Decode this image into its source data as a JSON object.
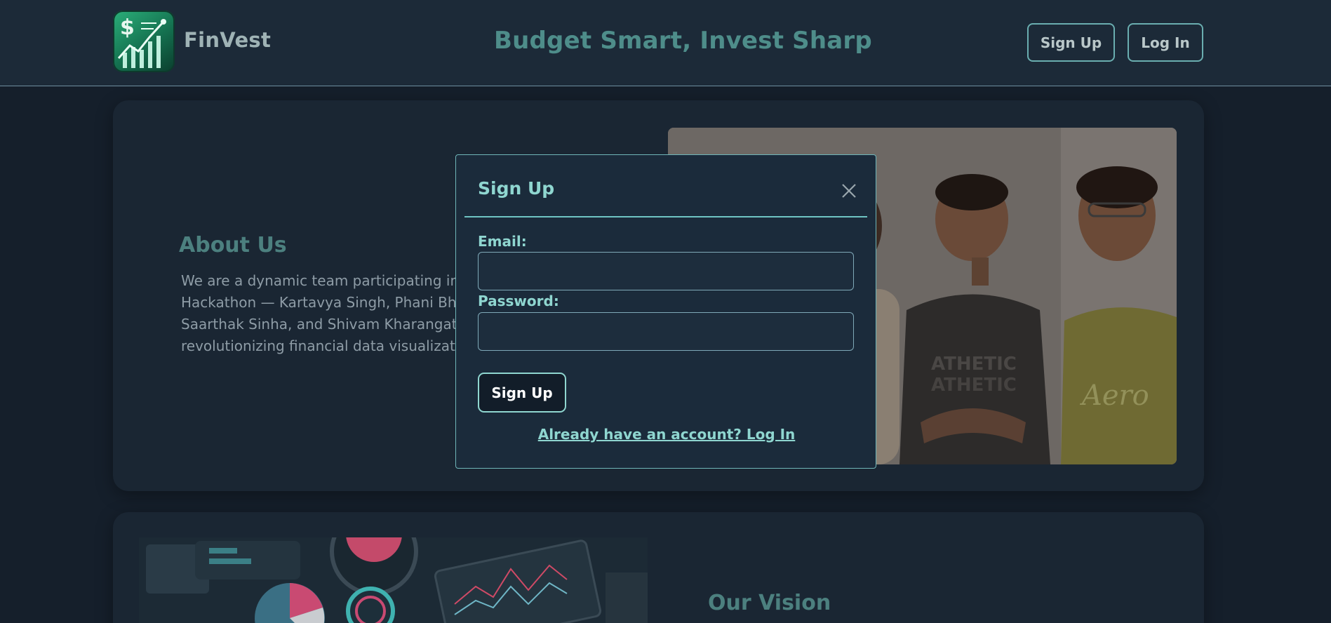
{
  "header": {
    "brand": "FinVest",
    "tagline": "Budget Smart, Invest Sharp",
    "signup_label": "Sign Up",
    "login_label": "Log In"
  },
  "about": {
    "title": "About Us",
    "text": "We are a dynamic team participating in t\nHackathon — Kartavya Singh, Phani Bhar\nSaarthak Sinha, and Shivam Kharangate\nrevolutionizing financial data visualizatio"
  },
  "vision": {
    "title": "Our Vision"
  },
  "modal": {
    "title": "Sign Up",
    "email_label": "Email:",
    "email_value": "",
    "password_label": "Password:",
    "password_value": "",
    "submit_label": "Sign Up",
    "switch_link": "Already have an account? Log In"
  },
  "icons": {
    "close": "close-icon",
    "logo": "finvest-logo-icon"
  },
  "colors": {
    "accent": "#8fd6d0",
    "header_bg": "#1c2a38",
    "modal_bg": "#1b2b3b"
  }
}
